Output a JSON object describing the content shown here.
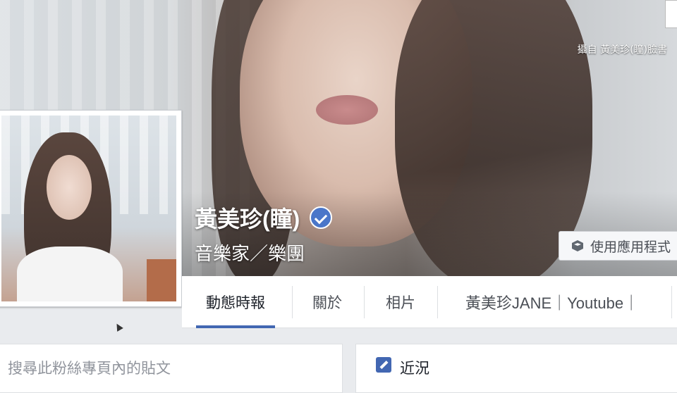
{
  "cover": {
    "credit": "攝自 黃美珍(瞳)臉書"
  },
  "page": {
    "name": "黃美珍(瞳)",
    "category": "音樂家／樂團",
    "verified": true
  },
  "app_button": {
    "icon": "cube-icon",
    "label": "使用應用程式"
  },
  "tabs": [
    {
      "label": "動態時報",
      "active": true
    },
    {
      "label": "關於",
      "active": false
    },
    {
      "label": "相片",
      "active": false
    },
    {
      "label": "黃美珍JANE｜Youtube｜",
      "active": false
    }
  ],
  "search": {
    "placeholder": "搜尋此粉絲專頁內的貼文"
  },
  "status": {
    "icon": "pencil-icon",
    "label": "近況"
  },
  "colors": {
    "accent": "#4267b2",
    "verified_badge": "#4a76c9",
    "background": "#e9ebee"
  }
}
